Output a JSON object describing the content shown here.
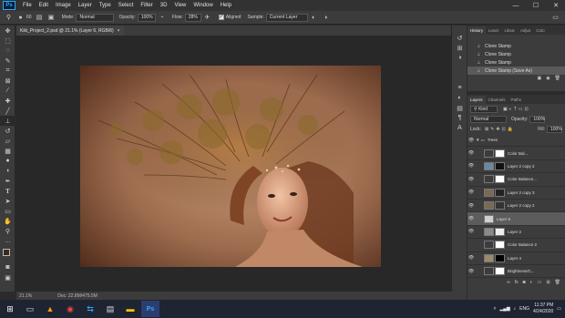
{
  "app": {
    "logo": "Ps"
  },
  "menu": [
    "File",
    "Edit",
    "Image",
    "Layer",
    "Type",
    "Select",
    "Filter",
    "3D",
    "View",
    "Window",
    "Help"
  ],
  "window_controls": {
    "minimize": "—",
    "maximize": "☐",
    "close": "✕"
  },
  "options": {
    "brush_size": "60",
    "mode_label": "Mode:",
    "mode_value": "Normal",
    "opacity_label": "Opacity:",
    "opacity_value": "100%",
    "flow_label": "Flow:",
    "flow_value": "28%",
    "aligned_label": "Aligned",
    "sample_label": "Sample:",
    "sample_value": "Current Layer"
  },
  "doc_tab": {
    "title": "Kiki_Project_2.psd @ 21.1% (Layer 6, RGB/8)",
    "close": "×"
  },
  "status": {
    "zoom": "21.1%",
    "doc": "Doc: 22.8M/475.5M"
  },
  "history": {
    "tabs": [
      "History",
      "Learn",
      "Librar",
      "Adjus",
      "Colo"
    ],
    "items": [
      "Clone Stamp",
      "Clone Stamp",
      "Clone Stamp",
      "Clone Stamp (Save As)"
    ]
  },
  "layers": {
    "tabs": [
      "Layers",
      "Channels",
      "Paths"
    ],
    "kind_label": "Kind",
    "blend_mode": "Normal",
    "opacity_label": "Opacity:",
    "opacity_value": "100%",
    "lock_label": "Lock:",
    "fill_label": "Fill:",
    "fill_value": "100%",
    "items": [
      {
        "name": "Trees",
        "type": "group"
      },
      {
        "name": "Color Bal..."
      },
      {
        "name": "Layer 2 copy 2"
      },
      {
        "name": "Color Balance..."
      },
      {
        "name": "Layer 2 copy 3"
      },
      {
        "name": "Layer 2 copy 2"
      },
      {
        "name": "Layer 6"
      },
      {
        "name": "Layer 2"
      },
      {
        "name": "Color Balance 2"
      },
      {
        "name": "Layer 4"
      },
      {
        "name": "Brightness/C..."
      }
    ]
  },
  "taskbar": {
    "time": "11:37 PM",
    "date": "4/24/2020",
    "lang": "ENG"
  }
}
